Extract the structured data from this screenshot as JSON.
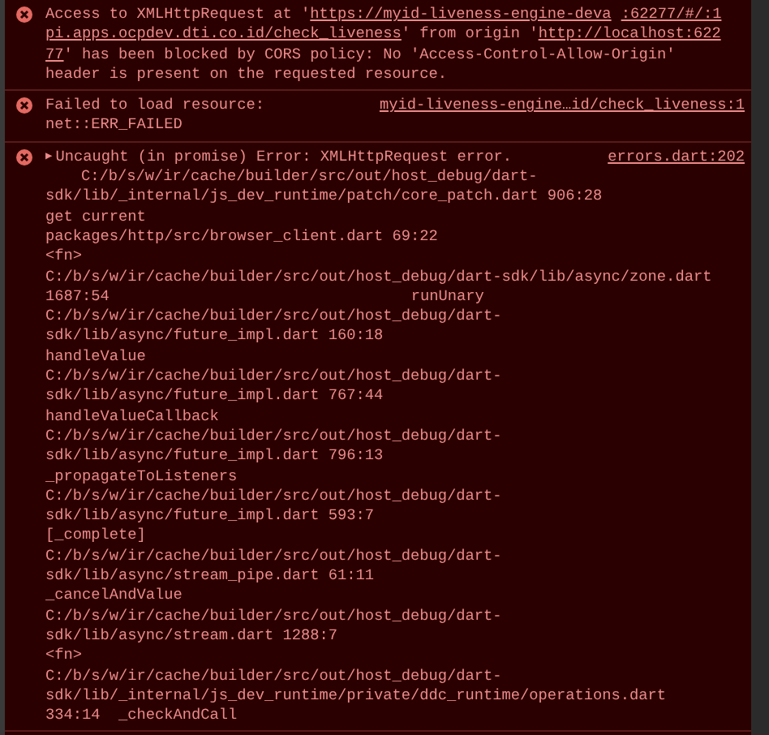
{
  "messages": [
    {
      "lines": [
        [
          {
            "text": "Access to XMLHttpRequest at '"
          },
          {
            "link": "https://myid-liveness-engine-deva"
          },
          {
            "link": ":62277/#/:1"
          }
        ],
        [
          {
            "link": "pi.apps.ocpdev.dti.co.id/check_liveness"
          },
          {
            "text": "' from origin '"
          },
          {
            "link": "http://localhost:622"
          }
        ],
        [
          {
            "link": "77"
          },
          {
            "text": "' has been blocked by CORS policy: No 'Access-Control-Allow-Origin'"
          }
        ],
        [
          {
            "text": "header is present on the requested resource."
          }
        ]
      ]
    },
    {
      "source": "myid-liveness-engine…id/check_liveness:1",
      "lines": [
        [
          {
            "text": "Failed to load resource:"
          }
        ],
        [
          {
            "text": "net::ERR_FAILED"
          }
        ]
      ]
    },
    {
      "expanded": false,
      "toggle": "▶",
      "source": "errors.dart:202",
      "lines": [
        [
          {
            "text": "Uncaught (in promise) Error: XMLHttpRequest error."
          }
        ]
      ],
      "stack": [
        {
          "text": "C:/b/s/w/ir/cache/builder/src/out/host_debug/dart-"
        },
        {
          "text": "sdk/lib/_internal/js_dev_runtime/patch/core_patch.dart 906:28"
        },
        {
          "text": "get current"
        },
        {
          "text": "packages/http/src/browser_client.dart 69:22"
        },
        {
          "text": "<fn>"
        },
        {
          "text": "C:/b/s/w/ir/cache/builder/src/out/host_debug/dart-sdk/lib/async/zone.dart"
        },
        {
          "text": "1687:54",
          "function": "runUnary"
        },
        {
          "text": "C:/b/s/w/ir/cache/builder/src/out/host_debug/dart-"
        },
        {
          "text": "sdk/lib/async/future_impl.dart 160:18"
        },
        {
          "text": "handleValue"
        },
        {
          "text": "C:/b/s/w/ir/cache/builder/src/out/host_debug/dart-"
        },
        {
          "text": "sdk/lib/async/future_impl.dart 767:44"
        },
        {
          "text": "handleValueCallback"
        },
        {
          "text": "C:/b/s/w/ir/cache/builder/src/out/host_debug/dart-"
        },
        {
          "text": "sdk/lib/async/future_impl.dart 796:13"
        },
        {
          "text": "_propagateToListeners"
        },
        {
          "text": "C:/b/s/w/ir/cache/builder/src/out/host_debug/dart-"
        },
        {
          "text": "sdk/lib/async/future_impl.dart 593:7"
        },
        {
          "text": "[_complete]"
        },
        {
          "text": "C:/b/s/w/ir/cache/builder/src/out/host_debug/dart-"
        },
        {
          "text": "sdk/lib/async/stream_pipe.dart 61:11"
        },
        {
          "text": "_cancelAndValue"
        },
        {
          "text": "C:/b/s/w/ir/cache/builder/src/out/host_debug/dart-"
        },
        {
          "text": "sdk/lib/async/stream.dart 1288:7"
        },
        {
          "text": "<fn>"
        },
        {
          "text": "C:/b/s/w/ir/cache/builder/src/out/host_debug/dart-"
        },
        {
          "text": "sdk/lib/_internal/js_dev_runtime/private/ddc_runtime/operations.dart"
        },
        {
          "text": "334:14  _checkAndCall"
        }
      ]
    }
  ]
}
